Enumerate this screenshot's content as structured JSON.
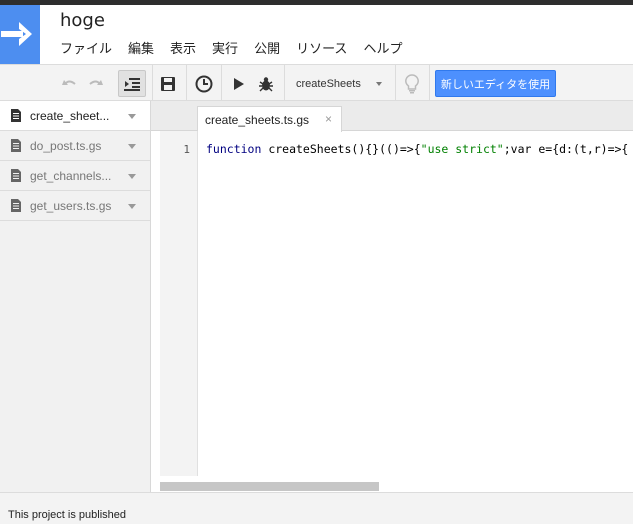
{
  "app": {
    "project_name": "hoge",
    "menu": [
      "ファイル",
      "編集",
      "表示",
      "実行",
      "公開",
      "リソース",
      "ヘルプ"
    ]
  },
  "toolbar": {
    "function_select": "createSheets",
    "new_editor_label": "新しいエディタを使用",
    "icons": [
      "undo-icon",
      "redo-icon",
      "indent-icon",
      "save-icon",
      "clock-icon",
      "run-icon",
      "debug-icon",
      "lightbulb-icon"
    ]
  },
  "files": [
    {
      "name": "create_sheet...",
      "active": true
    },
    {
      "name": "do_post.ts.gs",
      "active": false
    },
    {
      "name": "get_channels...",
      "active": false
    },
    {
      "name": "get_users.ts.gs",
      "active": false
    }
  ],
  "editor": {
    "tab_label": "create_sheets.ts.gs",
    "tab_close": "×",
    "line_number": "1",
    "code_kw": "function",
    "code_name": " createSheets(){}(()=>{",
    "code_str": "\"use strict\"",
    "code_rest": ";var e={d:(t,r)=>{"
  },
  "status": {
    "text": "This project is published"
  },
  "colors": {
    "logo_blue": "#4d8ef0",
    "button_blue": "#4d90fe"
  }
}
